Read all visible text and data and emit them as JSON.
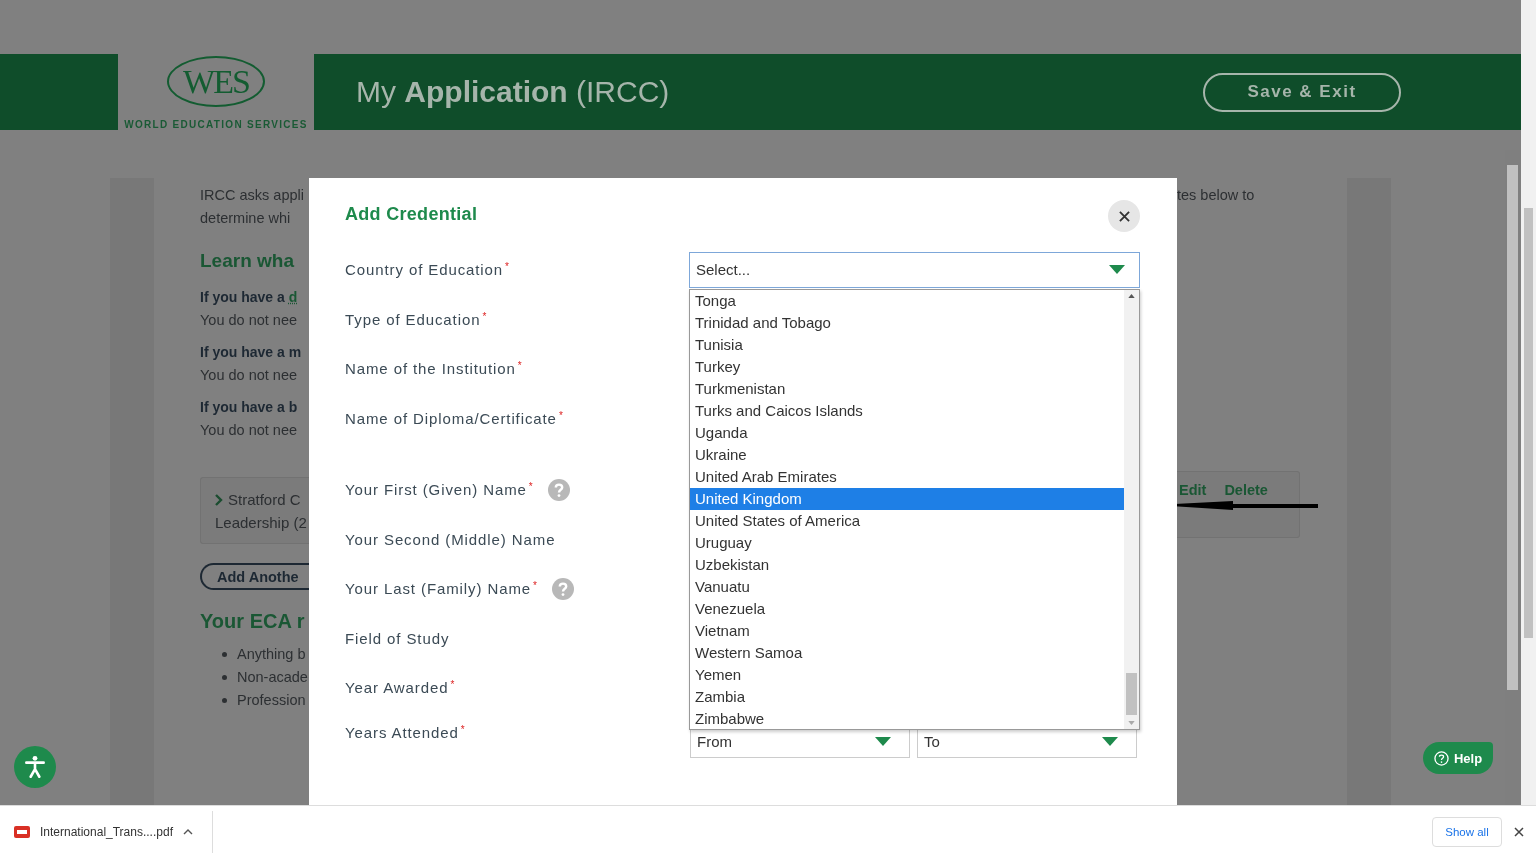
{
  "header": {
    "logo": {
      "mark": "WES",
      "name": "WORLD EDUCATION SERVICES"
    },
    "title": "My **Application** (IRCC)",
    "save_button": "Save & Exit"
  },
  "background": {
    "intro": [
      "IRCC asks appli",
      "determine whi"
    ],
    "intro_right": "tes below to",
    "heading": "Learn wha",
    "notes": [
      {
        "lead": "If you have a ",
        "link": "d",
        "text": "You do not nee"
      },
      {
        "lead": "If you have a m",
        "text": "You do not nee"
      },
      {
        "lead": "If you have a b",
        "text": "You do not nee"
      }
    ],
    "credential": {
      "lines": [
        "Stratford C",
        "Leadership (2"
      ],
      "actions": [
        "Edit",
        "Delete"
      ]
    },
    "add_button": "Add Anothe",
    "eca_heading": "Your ECA r",
    "bullets": [
      "Anything b",
      "Non-acade",
      "Profession"
    ]
  },
  "modal": {
    "title": "Add Credential",
    "fields": [
      {
        "label": "Country of Education",
        "marker": "*",
        "help": false
      },
      {
        "label": "Type of Education",
        "marker": "*",
        "help": false
      },
      {
        "label": "Name of the Institution",
        "marker": "*",
        "help": false
      },
      {
        "label": "Name of Diploma/Certificate",
        "marker": "*",
        "help": false
      },
      {
        "label": "Your First (Given) Name",
        "marker": "*",
        "help": true
      },
      {
        "label": "Your Second (Middle) Name",
        "help": false
      },
      {
        "label": "Your Last (Family) Name",
        "marker": "*",
        "help": true
      },
      {
        "label": "Field of Study",
        "help": false
      },
      {
        "label": "Year Awarded",
        "marker": "*",
        "help": false
      },
      {
        "label": "Years Attended",
        "marker": "*",
        "help": false
      }
    ],
    "country_select": {
      "placeholder": "Select...",
      "options": [
        {
          "label": "Tonga",
          "selected": false
        },
        {
          "label": "Trinidad and Tobago",
          "selected": false
        },
        {
          "label": "Tunisia",
          "selected": false
        },
        {
          "label": "Turkey",
          "selected": false
        },
        {
          "label": "Turkmenistan",
          "selected": false
        },
        {
          "label": "Turks and Caicos Islands",
          "selected": false
        },
        {
          "label": "Uganda",
          "selected": false
        },
        {
          "label": "Ukraine",
          "selected": false
        },
        {
          "label": "United Arab Emirates",
          "selected": false
        },
        {
          "label": "United Kingdom",
          "selected": true
        },
        {
          "label": "United States of America",
          "selected": false
        },
        {
          "label": "Uruguay",
          "selected": false
        },
        {
          "label": "Uzbekistan",
          "selected": false
        },
        {
          "label": "Vanuatu",
          "selected": false
        },
        {
          "label": "Venezuela",
          "selected": false
        },
        {
          "label": "Vietnam",
          "selected": false
        },
        {
          "label": "Western Samoa",
          "selected": false
        },
        {
          "label": "Yemen",
          "selected": false
        },
        {
          "label": "Zambia",
          "selected": false
        },
        {
          "label": "Zimbabwe",
          "selected": false
        }
      ]
    },
    "years": {
      "from": "From",
      "to": "To"
    }
  },
  "help_button": "Help",
  "download_bar": {
    "file": "International_Trans....pdf",
    "show_all": "Show all"
  }
}
